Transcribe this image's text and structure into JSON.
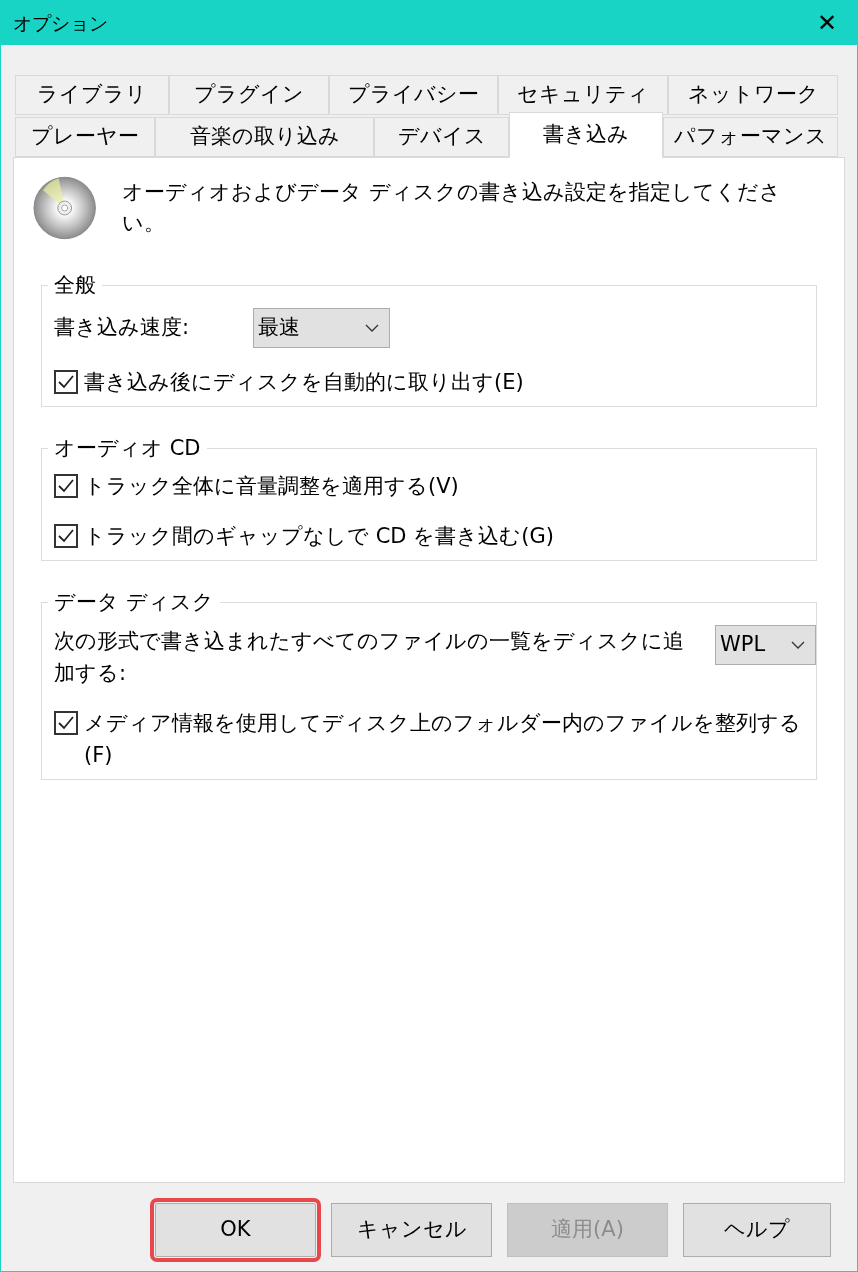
{
  "window": {
    "title": "オプション",
    "close": "✕"
  },
  "tab_rows": [
    {
      "tabs": [
        {
          "label": "ライブラリ",
          "selected": false
        },
        {
          "label": "プラグイン",
          "selected": false
        },
        {
          "label": "プライバシー",
          "selected": false
        },
        {
          "label": "セキュリティ",
          "selected": false
        },
        {
          "label": "ネットワーク",
          "selected": false
        }
      ]
    },
    {
      "tabs": [
        {
          "label": "プレーヤー",
          "selected": false
        },
        {
          "label": "音楽の取り込み",
          "selected": false
        },
        {
          "label": "デバイス",
          "selected": false
        },
        {
          "label": "書き込み",
          "selected": true
        },
        {
          "label": "パフォーマンス",
          "selected": false
        }
      ]
    }
  ],
  "description": "オーディオおよびデータ ディスクの書き込み設定を指定してください。",
  "groups": [
    {
      "title": "全般",
      "items": [
        {
          "kind": "dropdown",
          "label": "書き込み速度:",
          "value": "最速"
        },
        {
          "kind": "checkbox",
          "label": "書き込み後にディスクを自動的に取り出す(E)",
          "checked": true
        }
      ]
    },
    {
      "title": "オーディオ CD",
      "items": [
        {
          "kind": "checkbox",
          "label": "トラック全体に音量調整を適用する(V)",
          "checked": true
        },
        {
          "kind": "checkbox",
          "label": "トラック間のギャップなしで CD を書き込む(G)",
          "checked": true
        }
      ]
    },
    {
      "title": "データ ディスク",
      "items": [
        {
          "kind": "dropdown",
          "label": "次の形式で書き込まれたすべてのファイルの一覧をディスクに追加する:",
          "value": "WPL"
        },
        {
          "kind": "checkbox",
          "label": "メディア情報を使用してディスク上のフォルダー内のファイルを整列する(F)",
          "checked": true
        }
      ]
    }
  ],
  "buttons": [
    {
      "label": "OK",
      "disabled": false,
      "highlighted": true
    },
    {
      "label": "キャンセル",
      "disabled": false,
      "highlighted": false
    },
    {
      "label": "適用(A)",
      "disabled": true,
      "highlighted": false
    },
    {
      "label": "ヘルプ",
      "disabled": false,
      "highlighted": false
    }
  ]
}
